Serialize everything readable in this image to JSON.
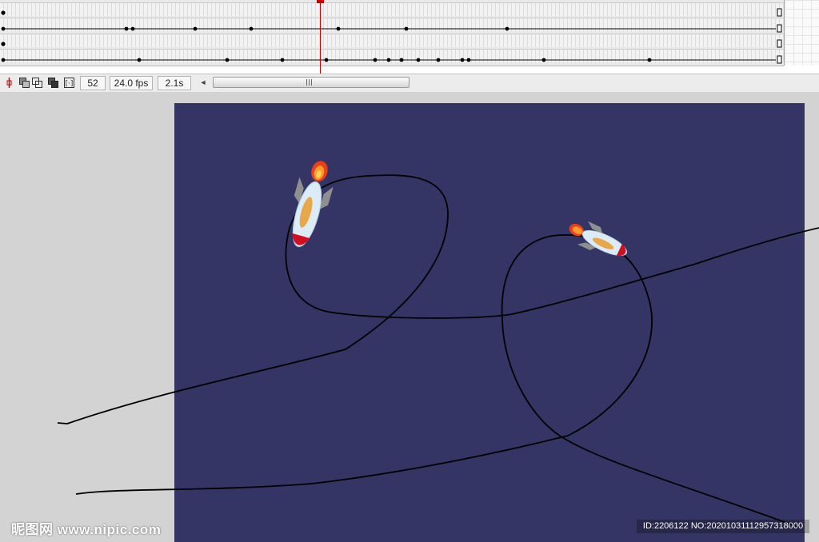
{
  "toolbar": {
    "frame_value": "52",
    "fps_value": "24.0 fps",
    "time_value": "2.1s",
    "scroll_grip": "III",
    "scroll_left_arrow": "◄"
  },
  "icons": {
    "center_frame": "center-frame-icon",
    "onion_skin": "onion-skin-icon",
    "onion_skin_outlines": "onion-skin-outlines-icon",
    "edit_multiple_frames": "edit-multiple-frames-icon",
    "modify_onion_markers": "modify-onion-markers-icon"
  },
  "colors": {
    "stage_background": "#343465",
    "workspace_background": "#d3d3d3",
    "playhead": "#cc0000",
    "motion_path": "#000000"
  },
  "watermark": {
    "brand_text": "昵图网 www.nipic.com",
    "image_id": "ID:2206122 NO:20201031112957318000"
  }
}
